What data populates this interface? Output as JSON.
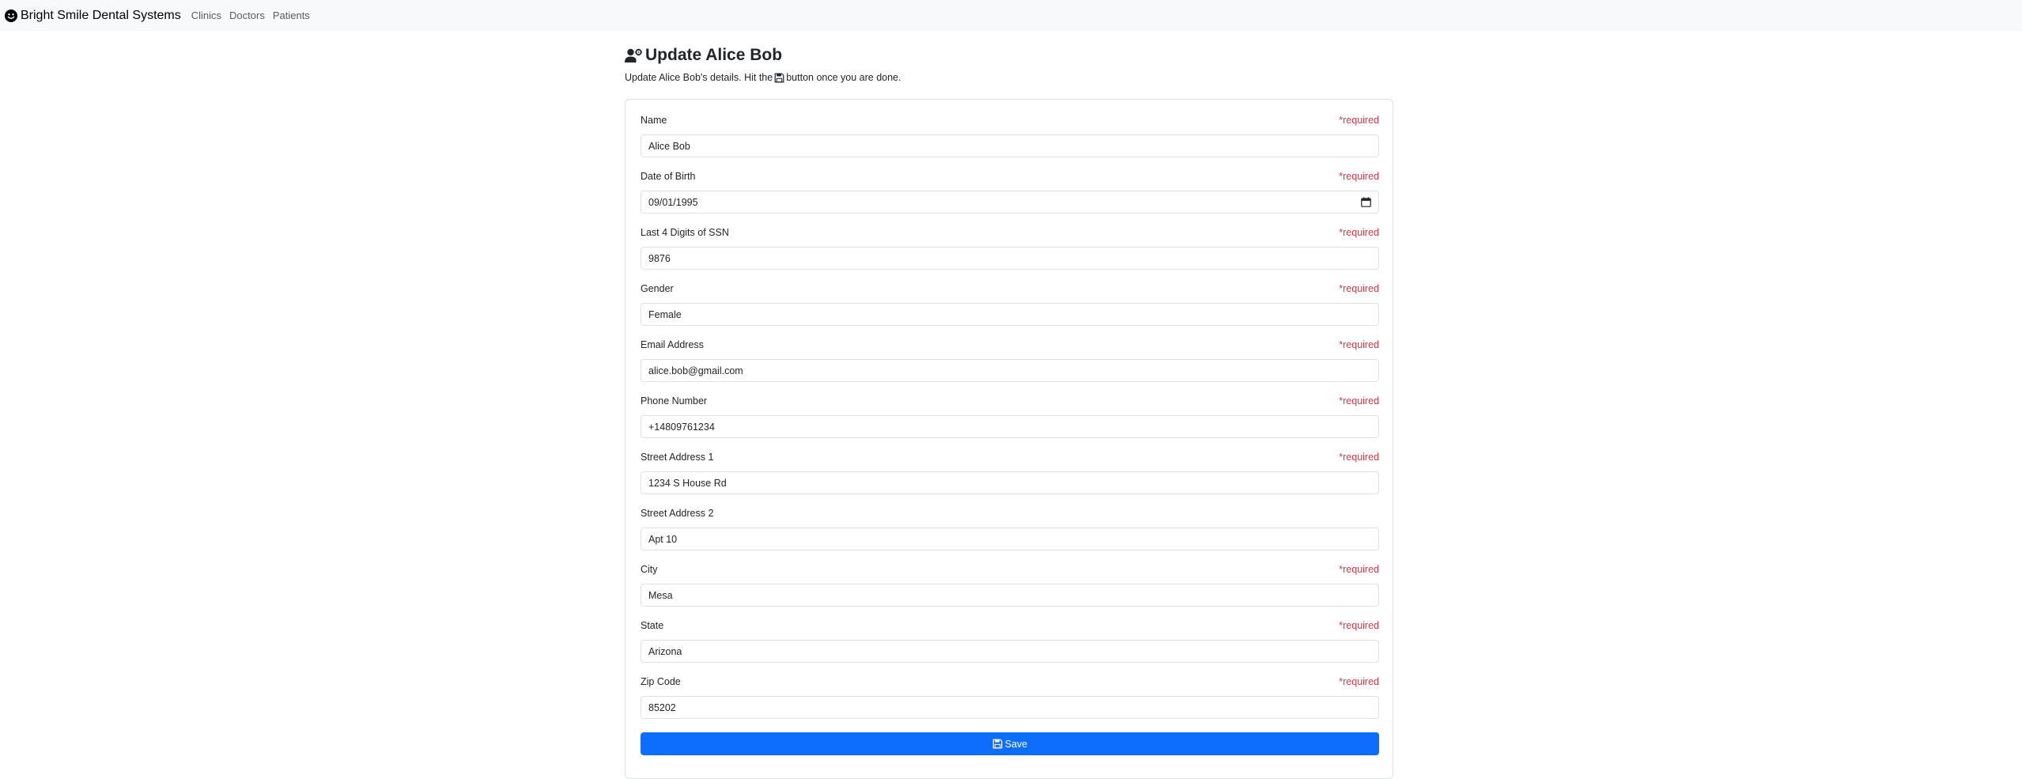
{
  "navbar": {
    "brand_icon": "smile-icon",
    "brand": "Bright Smile Dental Systems",
    "links": [
      "Clinics",
      "Doctors",
      "Patients"
    ]
  },
  "header": {
    "icon": "user-gear-icon",
    "title": "Update Alice Bob",
    "subtitle_before": "Update Alice Bob's details. Hit the",
    "subtitle_icon": "floppy-disk-icon",
    "subtitle_after": "button once you are done."
  },
  "form": {
    "required_text": "*required",
    "fields": [
      {
        "label": "Name",
        "value": "Alice Bob",
        "required": true
      },
      {
        "label": "Date of Birth",
        "value": "09/01/1995",
        "required": true
      },
      {
        "label": "Last 4 Digits of SSN",
        "value": "9876",
        "required": true
      },
      {
        "label": "Gender",
        "value": "Female",
        "required": true
      },
      {
        "label": "Email Address",
        "value": "alice.bob@gmail.com",
        "required": true
      },
      {
        "label": "Phone Number",
        "value": "+14809761234",
        "required": true
      },
      {
        "label": "Street Address 1",
        "value": "1234 S House Rd",
        "required": true
      },
      {
        "label": "Street Address 2",
        "value": "Apt 10",
        "required": false
      },
      {
        "label": "City",
        "value": "Mesa",
        "required": true
      },
      {
        "label": "State",
        "value": "Arizona",
        "required": true
      },
      {
        "label": "Zip Code",
        "value": "85202",
        "required": true
      }
    ],
    "save_label": "Save",
    "save_icon": "floppy-disk-icon"
  },
  "colors": {
    "primary": "#0d6efd",
    "required": "#dc3545",
    "navbar_bg": "#f8f9fa"
  }
}
